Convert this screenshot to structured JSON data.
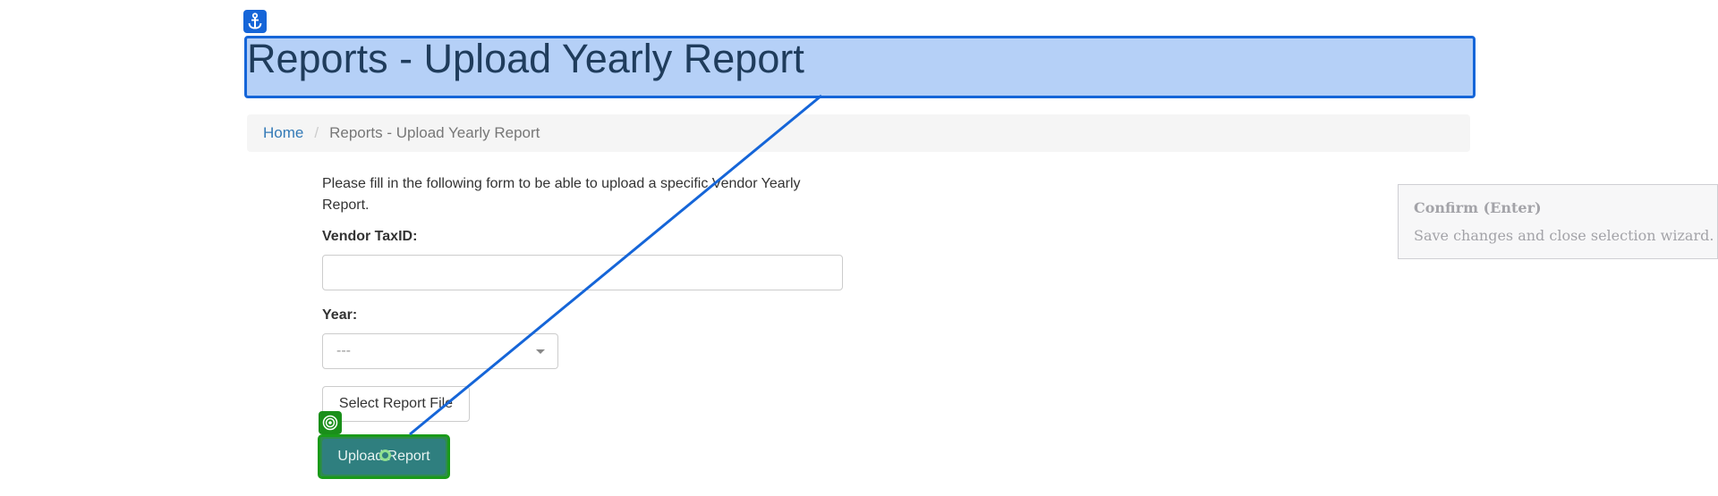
{
  "header": {
    "title": "Reports - Upload Yearly Report"
  },
  "breadcrumb": {
    "home": "Home",
    "separator": "/",
    "current": "Reports - Upload Yearly Report"
  },
  "form": {
    "intro": "Please fill in the following form to be able to upload a specific Vendor Yearly Report.",
    "vendor_label": "Vendor TaxID:",
    "vendor_value": "",
    "year_label": "Year:",
    "year_selected": "---",
    "file_button": "Select Report File",
    "upload_button": "Upload Report"
  },
  "overlay": {
    "anchor_icon": "anchor-icon",
    "target_icon": "target-icon",
    "tooltip_title": "Confirm (Enter)",
    "tooltip_body": "Save changes and close selection wizard.",
    "colors": {
      "anchor": "#1565d8",
      "target": "#1a9a1a",
      "button": "#2f7f7f"
    }
  }
}
